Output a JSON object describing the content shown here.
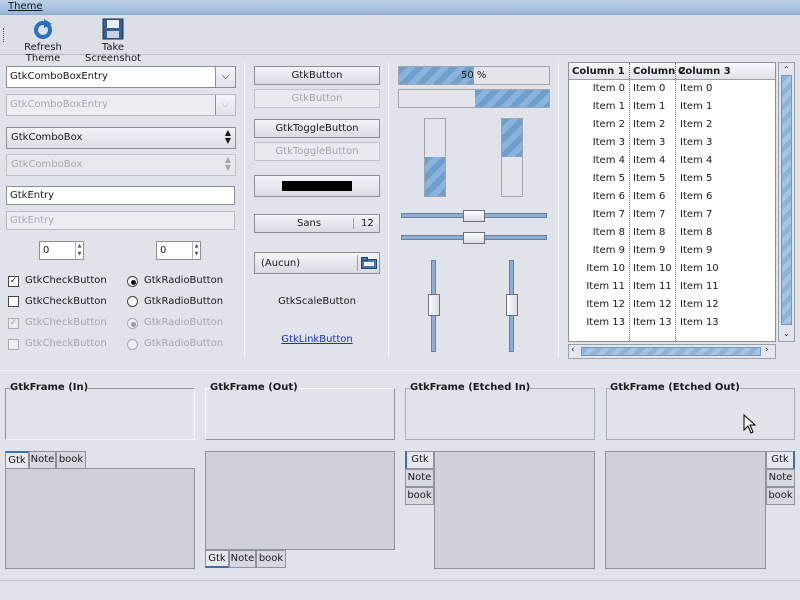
{
  "menubar": {
    "theme": "Theme"
  },
  "toolbar": {
    "refresh": "Refresh Theme",
    "screenshot": "Take Screenshot"
  },
  "col1": {
    "combo_entry": "GtkComboBoxEntry",
    "combo_entry_dis": "GtkComboBoxEntry",
    "combo": "GtkComboBox",
    "combo_dis": "GtkComboBox",
    "entry": "GtkEntry",
    "entry_dis": "GtkEntry",
    "spin1": "0",
    "spin2": "0",
    "check1": "GtkCheckButton",
    "check2": "GtkCheckButton",
    "check3": "GtkCheckButton",
    "check4": "GtkCheckButton",
    "radio1": "GtkRadioButton",
    "radio2": "GtkRadioButton",
    "radio3": "GtkRadioButton",
    "radio4": "GtkRadioButton"
  },
  "col2": {
    "button": "GtkButton",
    "button_dis": "GtkButton",
    "toggle": "GtkToggleButton",
    "toggle_dis": "GtkToggleButton",
    "font_name": "Sans",
    "font_size": "12",
    "file": "(Aucun)",
    "scale_button": "GtkScaleButton",
    "link": "GtkLinkButton"
  },
  "col3": {
    "progress_text": "50 %",
    "progress1": 0.5,
    "progress2": 0.5
  },
  "tree": {
    "headers": [
      "Column 1",
      "Column 2",
      "Column 3"
    ],
    "rows": [
      "Item 0",
      "Item 1",
      "Item 2",
      "Item 3",
      "Item 4",
      "Item 5",
      "Item 6",
      "Item 7",
      "Item 8",
      "Item 9",
      "Item 10",
      "Item 11",
      "Item 12",
      "Item 13"
    ]
  },
  "frames": {
    "in": "GtkFrame (In)",
    "out": "GtkFrame (Out)",
    "etched_in": "GtkFrame (Etched In)",
    "etched_out": "GtkFrame (Etched Out)"
  },
  "notebook": {
    "tabs": [
      "Gtk",
      "Note",
      "book"
    ]
  }
}
